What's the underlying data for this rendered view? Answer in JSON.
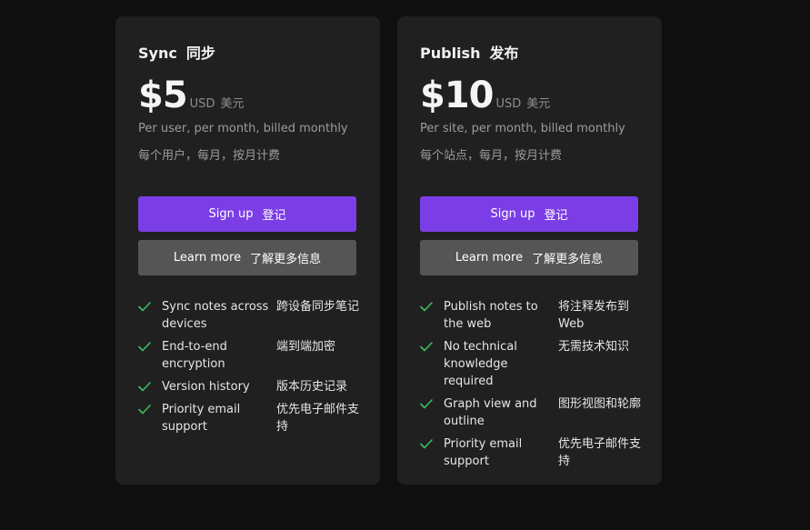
{
  "colors": {
    "background": "#0f0f0f",
    "card": "#202020",
    "primary_button": "#7b3ee6",
    "secondary_button": "#555555",
    "check": "#3dbd5c"
  },
  "plans": [
    {
      "name_en": "Sync",
      "name_cn": "同步",
      "price": "$5",
      "currency_en": "USD",
      "currency_cn": "美元",
      "desc_en": "Per user, per month, billed monthly",
      "desc_cn": "每个用户，每月，按月计费",
      "signup_en": "Sign up",
      "signup_cn": "登记",
      "learn_en": "Learn more",
      "learn_cn": "了解更多信息",
      "features": [
        {
          "icon": "check-icon",
          "en": "Sync notes across devices",
          "cn": "跨设备同步笔记"
        },
        {
          "icon": "check-icon",
          "en": "End-to-end encryption",
          "cn": "端到端加密"
        },
        {
          "icon": "check-icon",
          "en": "Version history",
          "cn": "版本历史记录"
        },
        {
          "icon": "check-icon",
          "en": "Priority email support",
          "cn": "优先电子邮件支持"
        }
      ]
    },
    {
      "name_en": "Publish",
      "name_cn": "发布",
      "price": "$10",
      "currency_en": "USD",
      "currency_cn": "美元",
      "desc_en": "Per site, per month, billed monthly",
      "desc_cn": "每个站点，每月，按月计费",
      "signup_en": "Sign up",
      "signup_cn": "登记",
      "learn_en": "Learn more",
      "learn_cn": "了解更多信息",
      "features": [
        {
          "icon": "check-icon",
          "en": "Publish notes to the web",
          "cn": "将注释发布到 Web"
        },
        {
          "icon": "check-icon",
          "en": "No technical knowledge required",
          "cn": "无需技术知识"
        },
        {
          "icon": "check-icon",
          "en": "Graph view and outline",
          "cn": "图形视图和轮廓"
        },
        {
          "icon": "check-icon",
          "en": "Priority email support",
          "cn": "优先电子邮件支持"
        }
      ]
    }
  ]
}
